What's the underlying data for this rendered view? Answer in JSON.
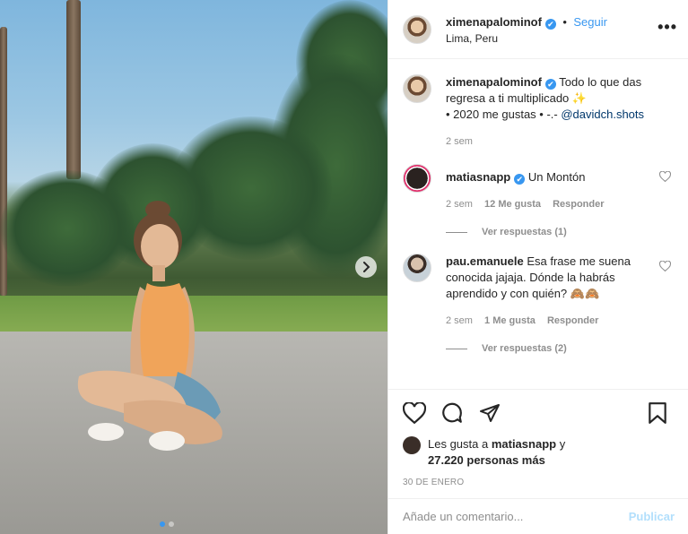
{
  "post": {
    "username": "ximenapalominof",
    "verified_glyph": "✔",
    "separator": "•",
    "follow_label": "Seguir",
    "location": "Lima, Peru",
    "more_label": "•••"
  },
  "caption": {
    "username": "ximenapalominof",
    "text_before": " Todo lo que das regresa a ti multiplicado ✨",
    "text_line2": "• 2020 me gustas • -.- ",
    "mention": "@davidch.shots",
    "time": "2 sem"
  },
  "comments": [
    {
      "username": "matiasnapp",
      "verified": true,
      "text": " Un Montón",
      "time": "2 sem",
      "likes": "12 Me gusta",
      "reply": "Responder",
      "view_replies": "Ver respuestas (1)"
    },
    {
      "username": "pau.emanuele",
      "verified": false,
      "text": " Esa frase me suena conocida jajaja. Dónde la habrás aprendido y con quién? 🙈🙈",
      "time": "2 sem",
      "likes": "1 Me gusta",
      "reply": "Responder",
      "view_replies": "Ver respuestas (2)"
    }
  ],
  "likes": {
    "prefix": "Les gusta a ",
    "user": "matiasnapp",
    "middle": " y",
    "count": "27.220 personas más"
  },
  "date": "30 DE ENERO",
  "add_comment": {
    "placeholder": "Añade un comentario...",
    "post_label": "Publicar"
  },
  "carousel": {
    "slides": 2,
    "active_index": 0
  },
  "colors": {
    "accent": "#3897f0",
    "post_disabled": "#b2dffc",
    "muted": "#8e8e8e"
  },
  "icons": [
    "heart-icon",
    "comment-icon",
    "share-icon",
    "bookmark-icon",
    "chevron-right-icon",
    "more-icon",
    "verified-icon"
  ]
}
